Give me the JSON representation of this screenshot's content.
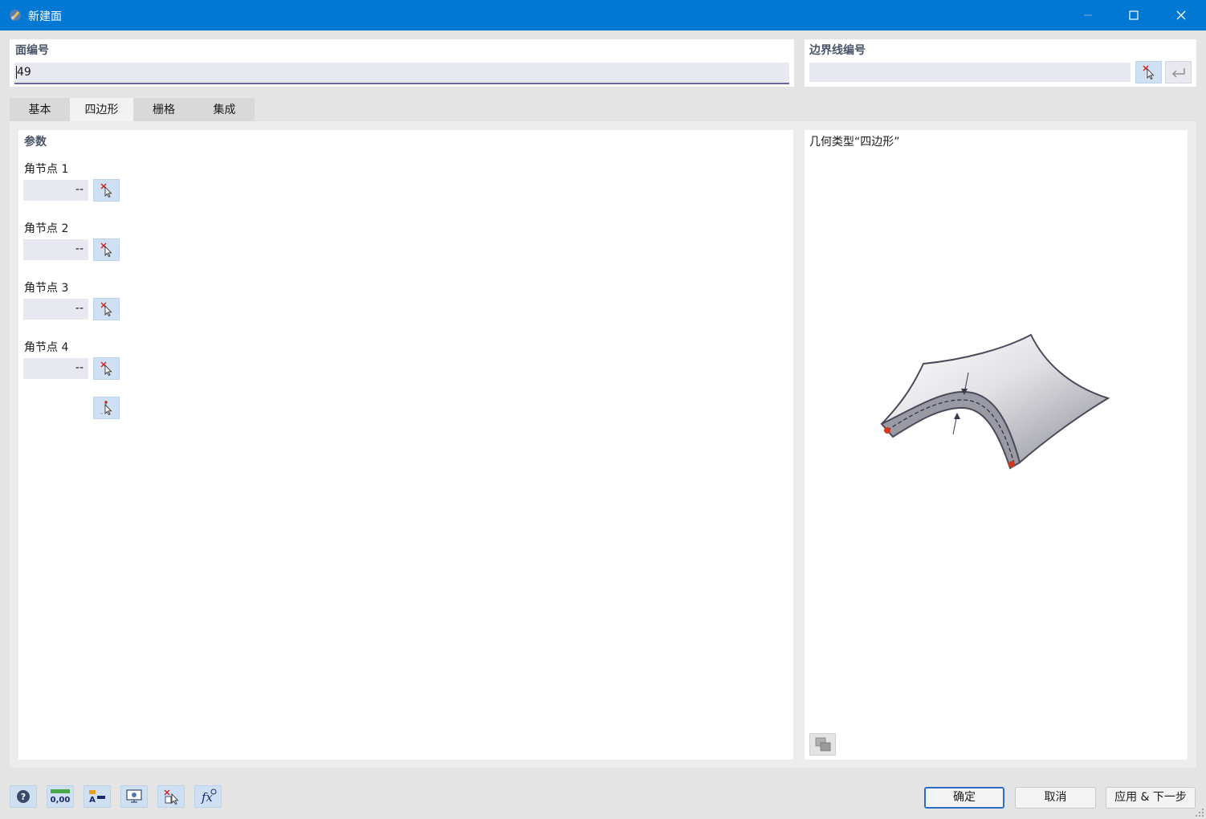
{
  "window": {
    "title": "新建面"
  },
  "surface_no": {
    "label": "面编号",
    "value": "49"
  },
  "boundary_lines": {
    "label": "边界线编号",
    "value": ""
  },
  "tabs": [
    {
      "label": "基本",
      "active": false
    },
    {
      "label": "四边形",
      "active": true
    },
    {
      "label": "栅格",
      "active": false
    },
    {
      "label": "集成",
      "active": false
    }
  ],
  "parameters": {
    "heading": "参数",
    "corner_nodes": [
      {
        "label": "角节点 1",
        "value": "--"
      },
      {
        "label": "角节点 2",
        "value": "--"
      },
      {
        "label": "角节点 3",
        "value": "--"
      },
      {
        "label": "角节点 4",
        "value": "--"
      }
    ]
  },
  "preview": {
    "title": "几何类型“四边形”"
  },
  "footer": {
    "ok": "确定",
    "cancel": "取消",
    "apply_next": "应用 & 下一步",
    "tool_icons": [
      "help-icon",
      "units-icon",
      "text-settings-icon",
      "view-icon",
      "select-icon",
      "formula-icon"
    ]
  },
  "colors": {
    "titlebar": "#0078d4",
    "accent": "#6b66a8",
    "pick_button": "#cfe0f2",
    "node_dot": "#d03a1c"
  }
}
